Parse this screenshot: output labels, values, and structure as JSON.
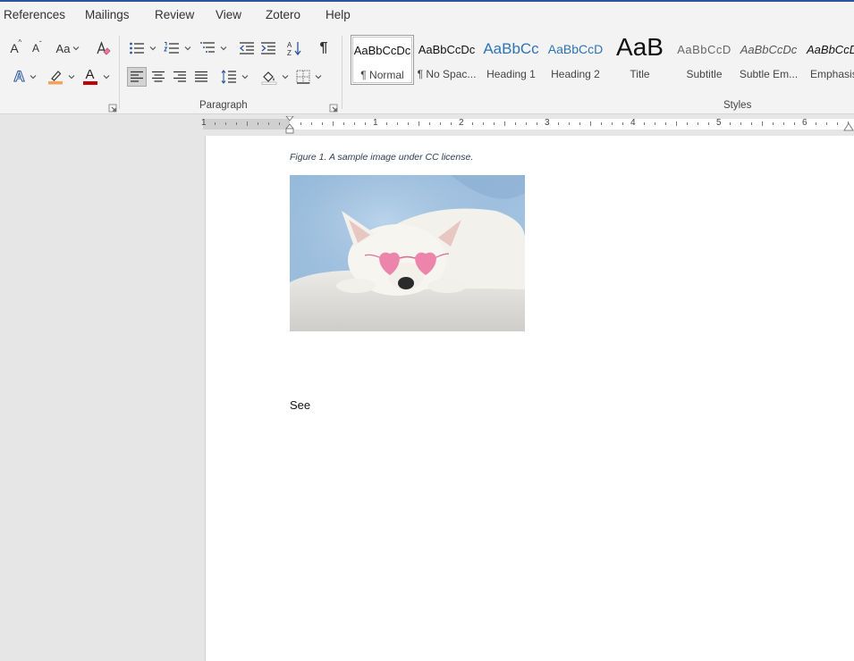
{
  "menu": {
    "items": [
      "References",
      "Mailings",
      "Review",
      "View",
      "Zotero",
      "Help"
    ]
  },
  "ribbon": {
    "font_group": {
      "grow_font_label": "A",
      "shrink_font_label": "A",
      "change_case_label": "Aa",
      "text_effects_label": "A",
      "font_color_label": "A"
    },
    "paragraph": {
      "label": "Paragraph",
      "show_marks_label": "¶"
    },
    "styles": {
      "label": "Styles",
      "items": [
        {
          "sample": "AaBbCcDc",
          "name": "¶ Normal"
        },
        {
          "sample": "AaBbCcDc",
          "name": "¶ No Spac..."
        },
        {
          "sample": "AaBbCc",
          "name": "Heading 1"
        },
        {
          "sample": "AaBbCcD",
          "name": "Heading 2"
        },
        {
          "sample": "AaB",
          "name": "Title"
        },
        {
          "sample": "AaBbCcD",
          "name": "Subtitle"
        },
        {
          "sample": "AaBbCcDc",
          "name": "Subtle Em..."
        },
        {
          "sample": "AaBbCcDc",
          "name": "Emphasis"
        }
      ]
    }
  },
  "ruler": {
    "labels": [
      "1",
      "1",
      "2",
      "3",
      "4",
      "5",
      "6"
    ]
  },
  "document": {
    "caption": "Figure 1. A sample image under CC license.",
    "body_text": "See"
  },
  "colors": {
    "accent": "#2b579a",
    "highlight": "#f3a25a",
    "font_color": "#c00000",
    "text_effect": "#2b579a"
  }
}
